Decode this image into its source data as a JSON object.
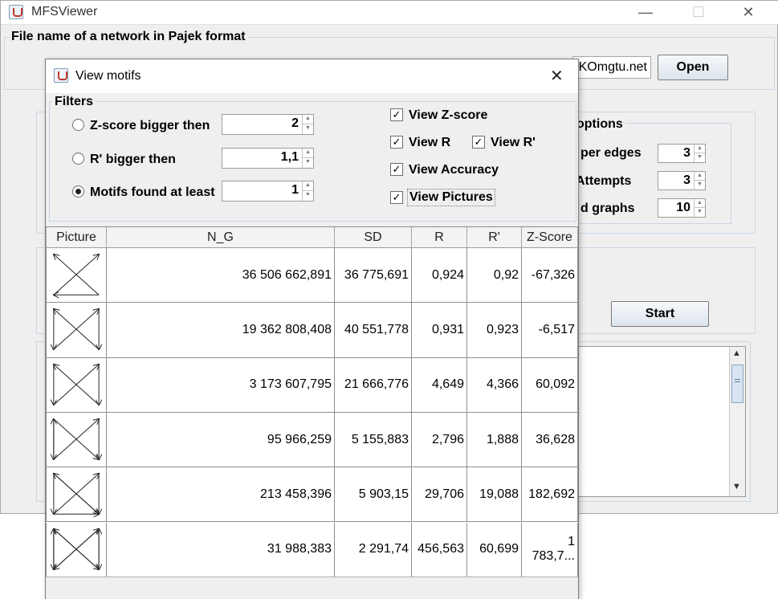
{
  "main_window": {
    "title": "MFSViewer",
    "controls": {
      "minimize": "—",
      "maximize": "☐",
      "close": "✕"
    },
    "file_group_title": "File name of a network in Pajek format",
    "file_field_value": "KOmgtu.net",
    "open_button": "Open",
    "options_group_title": "options",
    "options": [
      {
        "label": "per edges",
        "value": "3"
      },
      {
        "label": "Attempts",
        "value": "3"
      },
      {
        "label": "d graphs",
        "value": "10"
      }
    ],
    "start_button": "Start"
  },
  "dialog": {
    "title": "View motifs",
    "close": "✕",
    "filters_title": "Filters",
    "radios": [
      {
        "label": "Z-score bigger then",
        "value": "2",
        "selected": false
      },
      {
        "label": "R' bigger then",
        "value": "1,1",
        "selected": false
      },
      {
        "label": "Motifs found at least",
        "value": "1",
        "selected": true
      }
    ],
    "checkboxes": [
      {
        "label": "View Z-score",
        "checked": true
      },
      {
        "label": "View R",
        "checked": true
      },
      {
        "label": "View R'",
        "checked": true
      },
      {
        "label": "View Accuracy",
        "checked": true
      },
      {
        "label": "View Pictures",
        "checked": true
      }
    ],
    "table": {
      "headers": [
        "Picture",
        "N_G",
        "SD",
        "R",
        "R'",
        "Z-Score"
      ],
      "rows": [
        {
          "motif": 1,
          "ng": "36 506 662,891",
          "sd": "36 775,691",
          "r": "0,924",
          "rp": "0,92",
          "z": "-67,326"
        },
        {
          "motif": 2,
          "ng": "19 362 808,408",
          "sd": "40 551,778",
          "r": "0,931",
          "rp": "0,923",
          "z": "-6,517"
        },
        {
          "motif": 3,
          "ng": "3 173 607,795",
          "sd": "21 666,776",
          "r": "4,649",
          "rp": "4,366",
          "z": "60,092"
        },
        {
          "motif": 4,
          "ng": "95 966,259",
          "sd": "5 155,883",
          "r": "2,796",
          "rp": "1,888",
          "z": "36,628"
        },
        {
          "motif": 5,
          "ng": "213 458,396",
          "sd": "5 903,15",
          "r": "29,706",
          "rp": "19,088",
          "z": "182,692"
        },
        {
          "motif": 6,
          "ng": "31 988,383",
          "sd": "2 291,74",
          "r": "456,563",
          "rp": "60,699",
          "z": "1 783,7..."
        }
      ]
    }
  }
}
